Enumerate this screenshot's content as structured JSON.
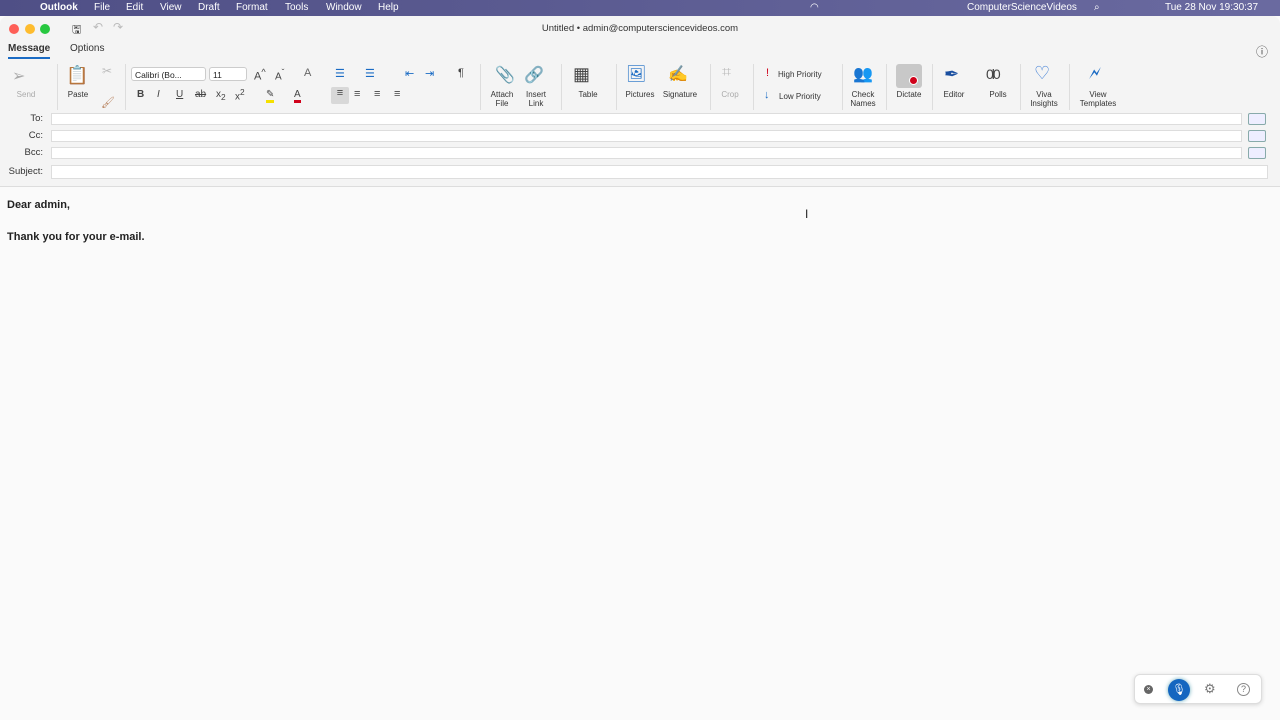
{
  "menubar": {
    "app": "Outlook",
    "items": [
      "File",
      "Edit",
      "View",
      "Draft",
      "Format",
      "Tools",
      "Window",
      "Help"
    ],
    "user": "ComputerScienceVideos",
    "datetime": "Tue 28 Nov  19:30:37"
  },
  "window": {
    "title": "Untitled • admin@computersciencevideos.com"
  },
  "tabs": [
    "Message",
    "Options"
  ],
  "ribbon": {
    "send": "Send",
    "paste": "Paste",
    "font": "Calibri (Bo...",
    "size": "11",
    "attach": [
      "Attach",
      "File"
    ],
    "link": [
      "Insert",
      "Link"
    ],
    "table": "Table",
    "pictures": "Pictures",
    "signature": "Signature",
    "crop": "Crop",
    "high": "High Priority",
    "low": "Low Priority",
    "check": [
      "Check",
      "Names"
    ],
    "dictate": "Dictate",
    "editor": "Editor",
    "polls": "Polls",
    "viva": [
      "Viva",
      "Insights"
    ],
    "templates": [
      "View",
      "Templates"
    ]
  },
  "fields": {
    "to": "To:",
    "cc": "Cc:",
    "bcc": "Bcc:",
    "subject": "Subject:"
  },
  "body": {
    "line1": "Dear admin,",
    "line2": "Thank you for your e-mail."
  },
  "colors": {
    "accent": "#1a6bc4",
    "menubar": "#5a5a90",
    "record": "#d0021b"
  }
}
